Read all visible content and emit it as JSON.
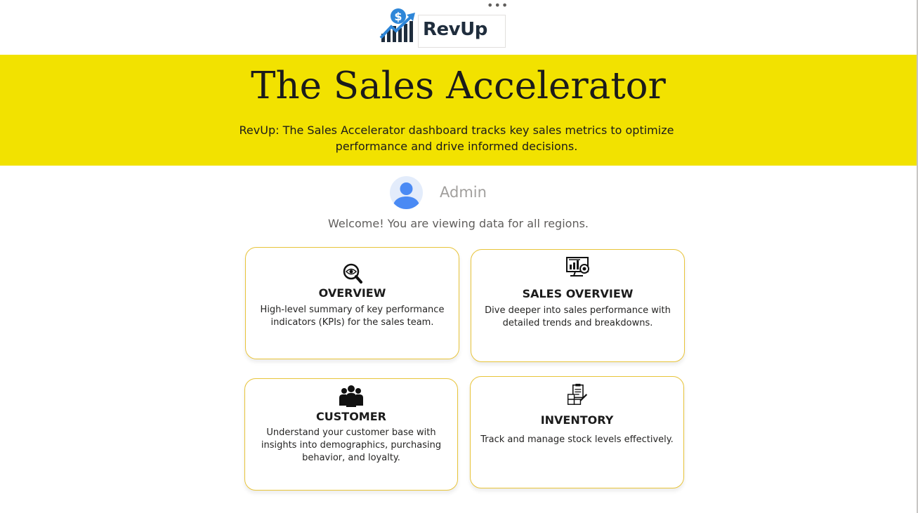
{
  "logo": {
    "brand": "RevUp",
    "icon": "dollar-growth-bar-chart"
  },
  "banner": {
    "title": "The Sales Accelerator",
    "description": "RevUp: The Sales Accelerator dashboard tracks key sales metrics to optimize performance and drive informed decisions."
  },
  "user": {
    "name": "Admin",
    "welcome": "Welcome! You are viewing data for all regions."
  },
  "cards": [
    {
      "title": "OVERVIEW",
      "description": "High-level summary of key performance indicators (KPIs) for the sales team.",
      "icon": "magnifier-eye-icon"
    },
    {
      "title": "SALES OVERVIEW",
      "description": "Dive deeper into sales performance with detailed trends and breakdowns.",
      "icon": "monitor-analytics-icon"
    },
    {
      "title": "CUSTOMER",
      "description": "Understand your customer base with insights into demographics, purchasing behavior, and loyalty.",
      "icon": "people-group-icon"
    },
    {
      "title": "INVENTORY",
      "description": "Track and manage stock levels effectively.",
      "icon": "clipboard-boxes-icon"
    }
  ],
  "colors": {
    "banner": "#f2e200",
    "card_border": "#e8c43a",
    "brand_blue": "#2e86d8",
    "brand_dark": "#1f2d3d"
  }
}
